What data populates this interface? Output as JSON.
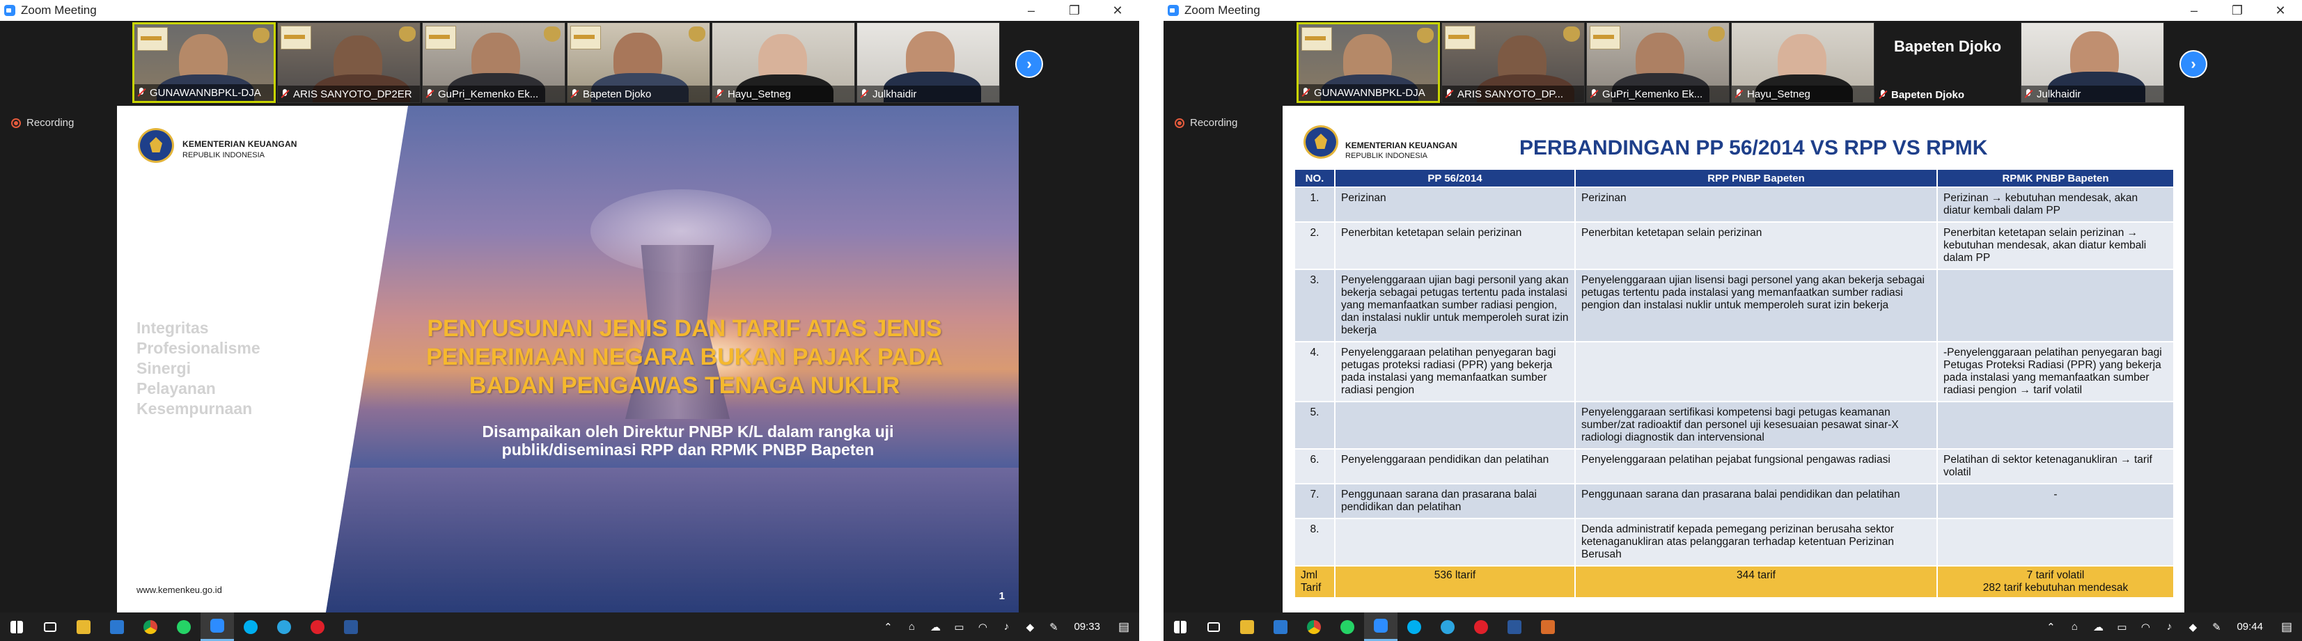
{
  "left": {
    "window_title": "Zoom Meeting",
    "recording_label": "Recording",
    "participants": [
      {
        "name": "GUNAWANNBPKL-DJA"
      },
      {
        "name": "ARIS SANYOTO_DP2ER"
      },
      {
        "name": "GuPri_Kemenko Ek..."
      },
      {
        "name": "Bapeten Djoko"
      },
      {
        "name": "Hayu_Setneg"
      },
      {
        "name": "Julkhaidir"
      }
    ],
    "slide": {
      "org_name": "KEMENTERIAN KEUANGAN",
      "org_sub": "REPUBLIK INDONESIA",
      "values": [
        "Integritas",
        "Profesionalisme",
        "Sinergi",
        "Pelayanan",
        "Kesempurnaan"
      ],
      "title_lines": [
        "PENYUSUNAN JENIS DAN TARIF ATAS JENIS",
        "PENERIMAAN NEGARA BUKAN PAJAK PADA",
        "BADAN PENGAWAS TENAGA NUKLIR"
      ],
      "subtitle_lines": [
        "Disampaikan oleh Direktur PNBP K/L dalam rangka uji",
        "publik/diseminasi RPP dan RPMK PNBP Bapeten"
      ],
      "website": "www.kemenkeu.go.id",
      "page_number": "1"
    },
    "clock": "09:33"
  },
  "right": {
    "window_title": "Zoom Meeting",
    "recording_label": "Recording",
    "participants": [
      {
        "name": "GUNAWANNBPKL-DJA"
      },
      {
        "name": "ARIS SANYOTO_DP..."
      },
      {
        "name": "GuPri_Kemenko Ek..."
      },
      {
        "name": "Hayu_Setneg"
      },
      {
        "name": "Bapeten Djoko",
        "big_label": "Bapeten Djoko"
      },
      {
        "name": "Julkhaidir"
      }
    ],
    "slide": {
      "org_name": "KEMENTERIAN KEUANGAN",
      "org_sub": "REPUBLIK INDONESIA",
      "title": "PERBANDINGAN PP 56/2014 VS RPP VS RPMK",
      "headers": [
        "NO.",
        "PP 56/2014",
        "RPP PNBP Bapeten",
        "RPMK PNBP Bapeten"
      ],
      "rows": [
        [
          "1.",
          "Perizinan",
          "Perizinan",
          "Perizinan → kebutuhan mendesak, akan diatur kembali dalam PP"
        ],
        [
          "2.",
          "Penerbitan ketetapan selain perizinan",
          "Penerbitan ketetapan selain perizinan",
          "Penerbitan ketetapan selain perizinan → kebutuhan mendesak, akan diatur kembali dalam PP"
        ],
        [
          "3.",
          "Penyelenggaraan ujian bagi personil yang akan bekerja sebagai petugas tertentu pada instalasi yang memanfaatkan sumber radiasi pengion, dan instalasi nuklir untuk memperoleh surat izin bekerja",
          "Penyelenggaraan ujian lisensi bagi personel yang akan bekerja sebagai petugas tertentu pada instalasi yang memanfaatkan sumber radiasi pengion dan instalasi nuklir untuk memperoleh surat izin bekerja",
          ""
        ],
        [
          "4.",
          "Penyelenggaraan pelatihan penyegaran bagi petugas proteksi radiasi (PPR) yang bekerja pada instalasi yang memanfaatkan sumber radiasi pengion",
          "",
          "-Penyelenggaraan pelatihan penyegaran bagi Petugas Proteksi Radiasi (PPR) yang bekerja pada instalasi yang memanfaatkan sumber radiasi pengion → tarif volatil"
        ],
        [
          "5.",
          "",
          "Penyelenggaraan sertifikasi kompetensi bagi petugas keamanan sumber/zat radioaktif dan personel uji kesesuaian pesawat sinar-X radiologi diagnostik dan intervensional",
          ""
        ],
        [
          "6.",
          "Penyelenggaraan pendidikan dan pelatihan",
          "Penyelenggaraan pelatihan pejabat fungsional pengawas radiasi",
          "Pelatihan di sektor ketenaganukliran → tarif volatil"
        ],
        [
          "7.",
          "Penggunaan sarana dan prasarana balai pendidikan dan pelatihan",
          "Penggunaan sarana dan prasarana balai pendidikan dan pelatihan",
          "-"
        ],
        [
          "8.",
          "",
          "Denda administratif kepada pemegang perizinan berusaha sektor ketenaganukliran atas pelanggaran terhadap ketentuan Perizinan Berusah",
          ""
        ]
      ],
      "total_row": {
        "label_1": "Jml",
        "label_2": "Tarif",
        "pp": "536 ltarif",
        "rpp": "344 tarif",
        "rpmk_1": "7 tarif volatil",
        "rpmk_2": "282 tarif kebutuhan mendesak"
      }
    },
    "clock": "09:44"
  },
  "icons": {
    "start": "windows-start-icon",
    "task_view": "task-view-icon",
    "explorer": "folder-icon",
    "mail": "mail-icon",
    "chrome": "chrome-icon",
    "whatsapp": "whatsapp-icon",
    "zoom": "zoom-icon",
    "skype": "skype-icon",
    "telegram": "telegram-icon",
    "opera": "opera-icon",
    "word": "word-icon"
  },
  "colors": {
    "zoom_blue": "#2d8cff",
    "slide_title_gold": "#f5b82e",
    "table_header": "#1e3f8a",
    "table_total": "#f1bf3d"
  }
}
